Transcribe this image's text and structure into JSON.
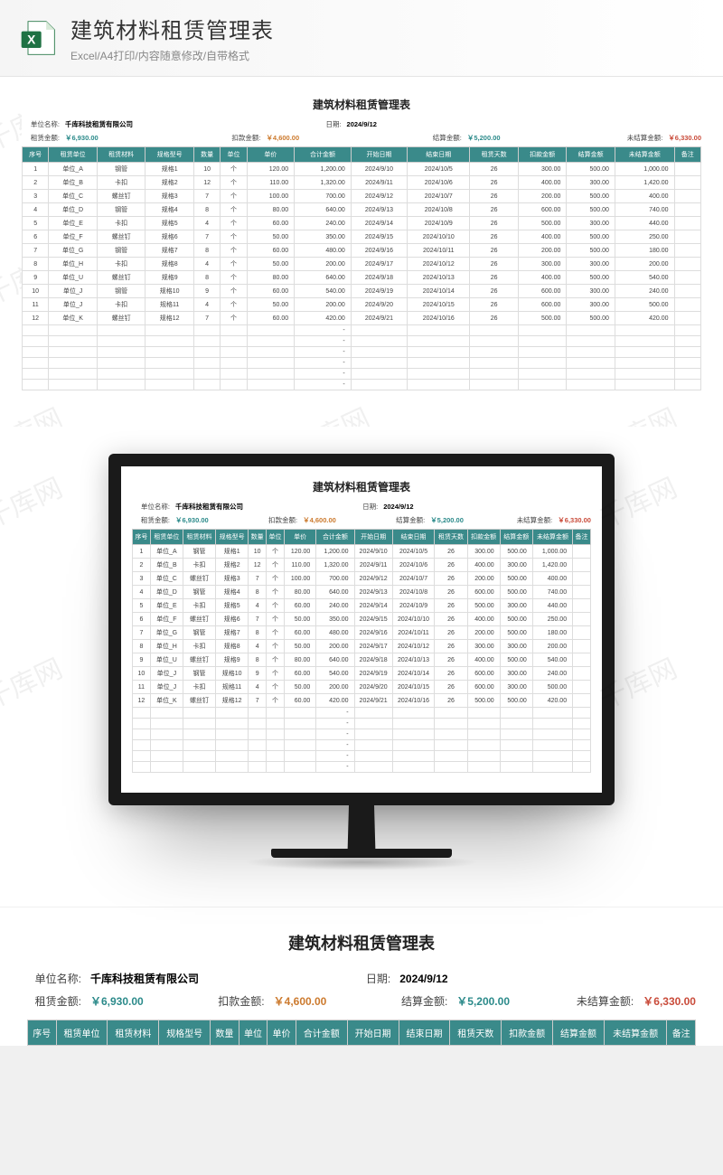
{
  "header": {
    "title": "建筑材料租赁管理表",
    "subtitle": "Excel/A4打印/内容随意修改/自带格式"
  },
  "watermark": "千库网",
  "sheet": {
    "title": "建筑材料租赁管理表",
    "company_label": "单位名称:",
    "company": "千库科技租赁有限公司",
    "date_label": "日期:",
    "date": "2024/9/12",
    "rent_amount_label": "租赁金额:",
    "rent_amount": "￥6,930.00",
    "deduct_label": "扣款金额:",
    "deduct": "￥4,600.00",
    "settle_label": "结算金额:",
    "settle": "￥5,200.00",
    "unsettle_label": "未结算金额:",
    "unsettle": "￥6,330.00",
    "columns": [
      "序号",
      "租赁单位",
      "租赁材料",
      "规格型号",
      "数量",
      "单位",
      "单价",
      "合计金额",
      "开始日期",
      "结束日期",
      "租赁天数",
      "扣款金额",
      "结算金额",
      "未结算金额",
      "备注"
    ],
    "rows": [
      {
        "n": "1",
        "u": "单位_A",
        "m": "钢管",
        "s": "规格1",
        "q": "10",
        "un": "个",
        "p": "120.00",
        "t": "1,200.00",
        "sd": "2024/9/10",
        "ed": "2024/10/5",
        "d": "26",
        "k": "300.00",
        "j": "500.00",
        "w": "1,000.00"
      },
      {
        "n": "2",
        "u": "单位_B",
        "m": "卡扣",
        "s": "规格2",
        "q": "12",
        "un": "个",
        "p": "110.00",
        "t": "1,320.00",
        "sd": "2024/9/11",
        "ed": "2024/10/6",
        "d": "26",
        "k": "400.00",
        "j": "300.00",
        "w": "1,420.00"
      },
      {
        "n": "3",
        "u": "单位_C",
        "m": "螺丝钉",
        "s": "规格3",
        "q": "7",
        "un": "个",
        "p": "100.00",
        "t": "700.00",
        "sd": "2024/9/12",
        "ed": "2024/10/7",
        "d": "26",
        "k": "200.00",
        "j": "500.00",
        "w": "400.00"
      },
      {
        "n": "4",
        "u": "单位_D",
        "m": "钢管",
        "s": "规格4",
        "q": "8",
        "un": "个",
        "p": "80.00",
        "t": "640.00",
        "sd": "2024/9/13",
        "ed": "2024/10/8",
        "d": "26",
        "k": "600.00",
        "j": "500.00",
        "w": "740.00"
      },
      {
        "n": "5",
        "u": "单位_E",
        "m": "卡扣",
        "s": "规格5",
        "q": "4",
        "un": "个",
        "p": "60.00",
        "t": "240.00",
        "sd": "2024/9/14",
        "ed": "2024/10/9",
        "d": "26",
        "k": "500.00",
        "j": "300.00",
        "w": "440.00"
      },
      {
        "n": "6",
        "u": "单位_F",
        "m": "螺丝钉",
        "s": "规格6",
        "q": "7",
        "un": "个",
        "p": "50.00",
        "t": "350.00",
        "sd": "2024/9/15",
        "ed": "2024/10/10",
        "d": "26",
        "k": "400.00",
        "j": "500.00",
        "w": "250.00"
      },
      {
        "n": "7",
        "u": "单位_G",
        "m": "钢管",
        "s": "规格7",
        "q": "8",
        "un": "个",
        "p": "60.00",
        "t": "480.00",
        "sd": "2024/9/16",
        "ed": "2024/10/11",
        "d": "26",
        "k": "200.00",
        "j": "500.00",
        "w": "180.00"
      },
      {
        "n": "8",
        "u": "单位_H",
        "m": "卡扣",
        "s": "规格8",
        "q": "4",
        "un": "个",
        "p": "50.00",
        "t": "200.00",
        "sd": "2024/9/17",
        "ed": "2024/10/12",
        "d": "26",
        "k": "300.00",
        "j": "300.00",
        "w": "200.00"
      },
      {
        "n": "9",
        "u": "单位_U",
        "m": "螺丝钉",
        "s": "规格9",
        "q": "8",
        "un": "个",
        "p": "80.00",
        "t": "640.00",
        "sd": "2024/9/18",
        "ed": "2024/10/13",
        "d": "26",
        "k": "400.00",
        "j": "500.00",
        "w": "540.00"
      },
      {
        "n": "10",
        "u": "单位_J",
        "m": "钢管",
        "s": "规格10",
        "q": "9",
        "un": "个",
        "p": "60.00",
        "t": "540.00",
        "sd": "2024/9/19",
        "ed": "2024/10/14",
        "d": "26",
        "k": "600.00",
        "j": "300.00",
        "w": "240.00"
      },
      {
        "n": "11",
        "u": "单位_J",
        "m": "卡扣",
        "s": "规格11",
        "q": "4",
        "un": "个",
        "p": "50.00",
        "t": "200.00",
        "sd": "2024/9/20",
        "ed": "2024/10/15",
        "d": "26",
        "k": "600.00",
        "j": "300.00",
        "w": "500.00"
      },
      {
        "n": "12",
        "u": "单位_K",
        "m": "螺丝钉",
        "s": "规格12",
        "q": "7",
        "un": "个",
        "p": "60.00",
        "t": "420.00",
        "sd": "2024/9/21",
        "ed": "2024/10/16",
        "d": "26",
        "k": "500.00",
        "j": "500.00",
        "w": "420.00"
      }
    ],
    "empty_rows": 6
  }
}
